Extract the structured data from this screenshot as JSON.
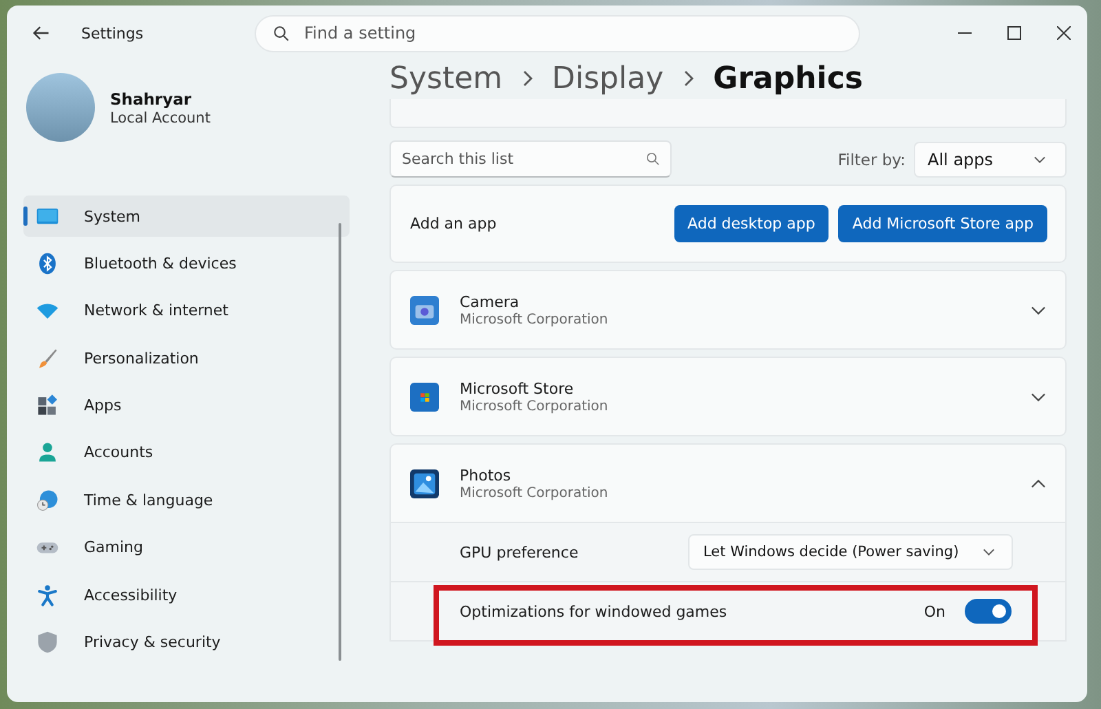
{
  "window": {
    "title": "Settings",
    "search_placeholder": "Find a setting"
  },
  "profile": {
    "name": "Shahryar",
    "account": "Local Account"
  },
  "nav": [
    {
      "label": "System",
      "selected": true
    },
    {
      "label": "Bluetooth & devices",
      "selected": false
    },
    {
      "label": "Network & internet",
      "selected": false
    },
    {
      "label": "Personalization",
      "selected": false
    },
    {
      "label": "Apps",
      "selected": false
    },
    {
      "label": "Accounts",
      "selected": false
    },
    {
      "label": "Time & language",
      "selected": false
    },
    {
      "label": "Gaming",
      "selected": false
    },
    {
      "label": "Accessibility",
      "selected": false
    },
    {
      "label": "Privacy & security",
      "selected": false
    }
  ],
  "breadcrumb": [
    "System",
    "Display",
    "Graphics"
  ],
  "list_search": {
    "placeholder": "Search this list"
  },
  "filter": {
    "label": "Filter by:",
    "value": "All apps"
  },
  "add_app": {
    "label": "Add an app",
    "buttons": [
      "Add desktop app",
      "Add Microsoft Store app"
    ]
  },
  "apps": [
    {
      "name": "Camera",
      "publisher": "Microsoft Corporation",
      "expanded": false
    },
    {
      "name": "Microsoft Store",
      "publisher": "Microsoft Corporation",
      "expanded": false
    },
    {
      "name": "Photos",
      "publisher": "Microsoft Corporation",
      "expanded": true,
      "settings": [
        {
          "kind": "dropdown",
          "label": "GPU preference",
          "value": "Let Windows decide (Power saving)",
          "highlighted": false
        },
        {
          "kind": "toggle",
          "label": "Optimizations for windowed games",
          "state_text": "On",
          "on": true,
          "highlighted": true
        }
      ]
    }
  ]
}
